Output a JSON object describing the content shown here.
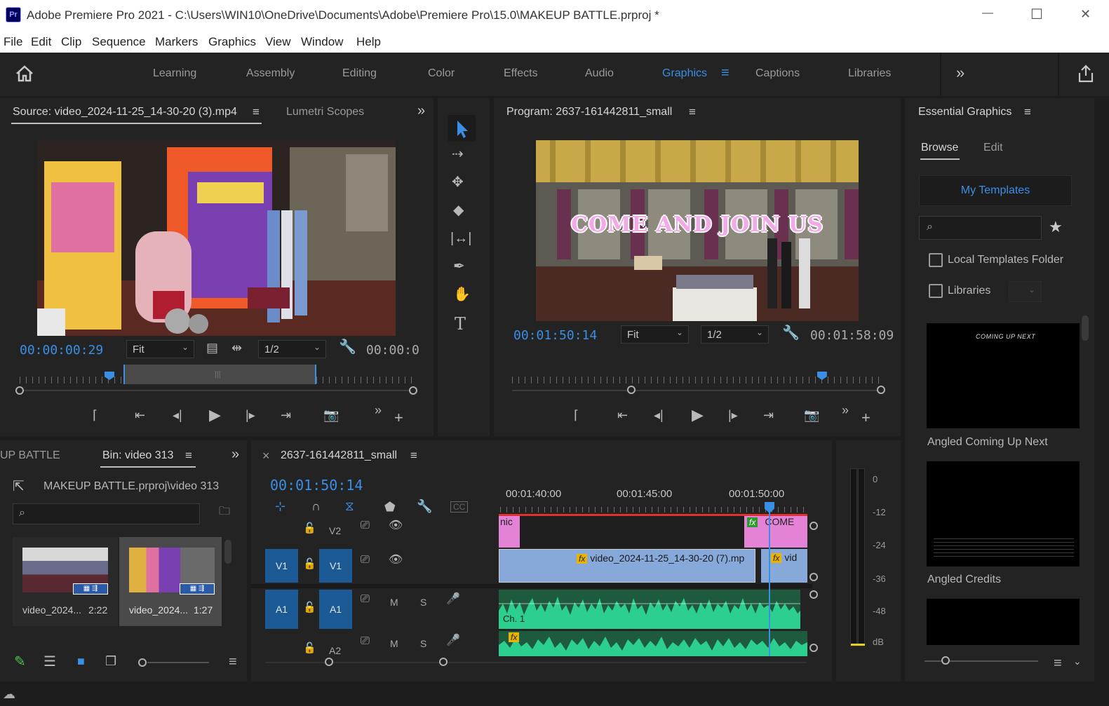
{
  "window": {
    "title": "Adobe Premiere Pro 2021 - C:\\Users\\WIN10\\OneDrive\\Documents\\Adobe\\Premiere Pro\\15.0\\MAKEUP BATTLE.prproj *",
    "app_badge": "Pr",
    "controls": {
      "minimize": "—",
      "maximize": "☐",
      "close": "✕"
    }
  },
  "menu": [
    "File",
    "Edit",
    "Clip",
    "Sequence",
    "Markers",
    "Graphics",
    "View",
    "Window",
    "Help"
  ],
  "workspaces": {
    "items": [
      "Learning",
      "Assembly",
      "Editing",
      "Color",
      "Effects",
      "Audio",
      "Graphics",
      "Captions",
      "Libraries"
    ],
    "active": "Graphics",
    "more": "»",
    "menu_glyph": "≡"
  },
  "source_monitor": {
    "tab": "Source: video_2024-11-25_14-30-20 (3).mp4",
    "tab2": "Lumetri Scopes",
    "more": "»",
    "timecode": "00:00:00:29",
    "fit": "Fit",
    "resolution": "1/2",
    "duration": "00:00:0",
    "playhead_position": 0.23,
    "in_out_range": [
      0.26,
      0.74
    ]
  },
  "program_monitor": {
    "tab": "Program: 2637-161442811_small",
    "overlay_title": "COME AND JOIN US",
    "timecode": "00:01:50:14",
    "fit": "Fit",
    "resolution": "1/2",
    "duration": "00:01:58:09",
    "playhead_position": 0.84
  },
  "tools": [
    "selection-tool",
    "track-select-tool",
    "ripple-edit-tool",
    "razor-tool",
    "slip-tool",
    "pen-tool",
    "hand-tool",
    "type-tool"
  ],
  "project_panel": {
    "tab_partial": "UP BATTLE",
    "tab_bin": "Bin: video 313",
    "more": "»",
    "path": "MAKEUP BATTLE.prproj\\video 313",
    "items": [
      {
        "name": "video_2024...",
        "duration": "2:22"
      },
      {
        "name": "video_2024...",
        "duration": "1:27"
      }
    ]
  },
  "timeline": {
    "close": "×",
    "tab": "2637-161442811_small",
    "timecode": "00:01:50:14",
    "ruler_labels": [
      "00:01:40:00",
      "00:01:45:00",
      "00:01:50:00"
    ],
    "tracks": {
      "v2": {
        "label": "V2"
      },
      "v1": {
        "src": "V1",
        "label": "V1"
      },
      "a1": {
        "src": "A1",
        "label": "A1",
        "mute": "M",
        "solo": "S"
      },
      "a2": {
        "label": "A2",
        "mute": "M",
        "solo": "S"
      }
    },
    "clips": {
      "v2_left": "nic",
      "v2_right": "COME",
      "v1_main": "video_2024-11-25_14-30-20 (7).mp",
      "v1_right": "vid",
      "a1_label": "Ch. 1",
      "fx": "fx"
    }
  },
  "audio_meter": {
    "labels": [
      "0",
      "-12",
      "-24",
      "-36",
      "-48",
      "dB"
    ]
  },
  "essential_graphics": {
    "title": "Essential Graphics",
    "tabs": [
      "Browse",
      "Edit"
    ],
    "active_tab": "Browse",
    "my_templates": "My Templates",
    "star": "★",
    "checkboxes": [
      "Local Templates Folder",
      "Libraries"
    ],
    "templates": [
      {
        "name": "Angled Coming Up Next",
        "thumb_text": "COMING UP NEXT"
      },
      {
        "name": "Angled Credits",
        "thumb_text": ""
      }
    ]
  },
  "colors": {
    "accent": "#3a8ee6",
    "panel_bg": "#232323",
    "track_blue": "#1c5a96",
    "clip_pink": "#e483d6",
    "clip_video": "#86a9d9",
    "clip_audio": "#2ccf8e"
  }
}
